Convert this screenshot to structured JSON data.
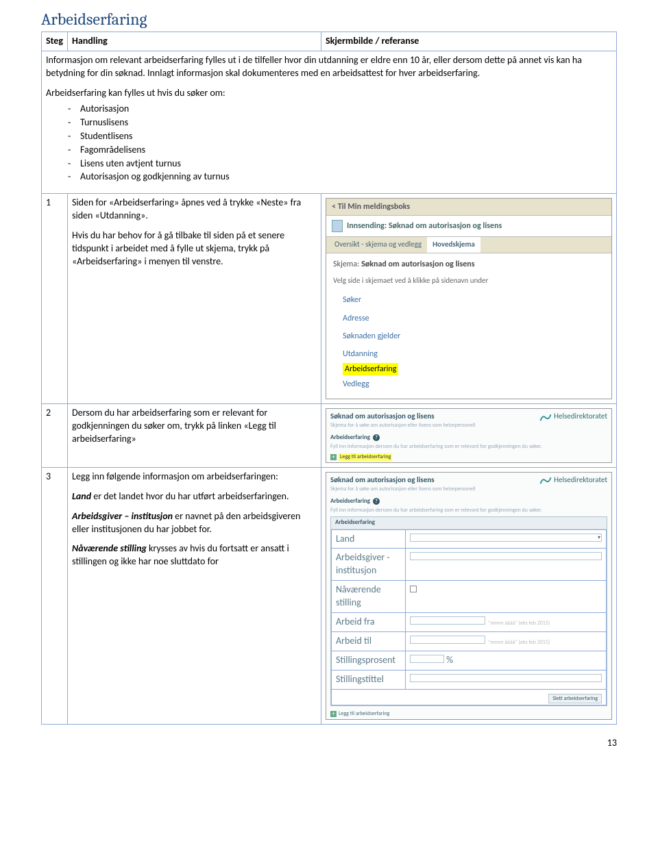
{
  "title": "Arbeidserfaring",
  "header": {
    "steg": "Steg",
    "handling": "Handling",
    "ref": "Skjermbilde / referanse"
  },
  "intro": {
    "p1": "Informasjon om relevant arbeidserfaring fylles ut i de tilfeller hvor din utdanning er eldre enn 10 år, eller dersom dette på annet vis kan ha betydning for din søknad. Innlagt informasjon skal dokumenteres med en arbeidsattest for hver arbeidserfaring.",
    "p2": "Arbeidserfaring kan fylles ut hvis du søker om:",
    "list": [
      "Autorisasjon",
      "Turnuslisens",
      "Studentlisens",
      "Fagområdelisens",
      "Lisens uten avtjent turnus",
      "Autorisasjon og godkjenning av turnus"
    ]
  },
  "row1": {
    "steg": "1",
    "p1": "Siden for «Arbeidserfaring» åpnes ved å trykke «Neste» fra siden «Utdanning».",
    "p2": "Hvis du har behov for å gå tilbake til siden på et senere tidspunkt i arbeidet med å fylle ut skjema, trykk på «Arbeidserfaring» i menyen til venstre."
  },
  "ss1": {
    "back": "< Til Min meldingsboks",
    "innsend": "Innsending: Søknad om autorisasjon og lisens",
    "tab1": "Oversikt - skjema og vedlegg",
    "tab2": "Hovedskjema",
    "schema_lbl": "Skjema:",
    "schema_val": "Søknad om autorisasjon og lisens",
    "hint": "Velg side i skjemaet ved å klikke på sidenavn under",
    "nav": [
      "Søker",
      "Adresse",
      "Søknaden gjelder",
      "Utdanning",
      "Arbeidserfaring",
      "Vedlegg"
    ]
  },
  "row2": {
    "steg": "2",
    "p1": "Dersom du har arbeidserfaring som er relevant for godkjenningen du søker om, trykk på linken «Legg til arbeidserfaring»"
  },
  "ss2": {
    "title": "Søknad om autorisasjon og lisens",
    "sub": "Skjema for å søke om autorisasjon eller lisens som helsepersonell",
    "logo": "Helsedirektoratet",
    "section": "Arbeidserfaring",
    "hint": "Fyll inn informasjon dersom du har arbeidserfaring som er relevant for godkjenningen du søker.",
    "addtext": "Legg til arbeidserfaring"
  },
  "row3": {
    "steg": "3",
    "p1": "Legg inn følgende informasjon om arbeidserfaringen:",
    "p2a": "Land ",
    "p2b": "er det landet hvor du har utført arbeidserfaringen.",
    "p3a": "Arbeidsgiver – institusjon ",
    "p3b": "er navnet på den arbeidsgiveren eller institusjonen du har jobbet for.",
    "p4a": "Nåværende stilling ",
    "p4b": "krysses av hvis du fortsatt er ansatt i stillingen og ikke har noe sluttdato for"
  },
  "ss3": {
    "title": "Søknad om autorisasjon og lisens",
    "sub": "Skjema for å søke om autorisasjon eller lisens som helsepersonell",
    "logo": "Helsedirektoratet",
    "section": "Arbeidserfaring",
    "hint": "Fyll inn informasjon dersom du har arbeidserfaring som er relevant for godkjenningen du søker.",
    "form_header": "Arbeidserfaring",
    "fields": {
      "land": "Land",
      "arbeidsgiver": "Arbeidsgiver - institusjon",
      "navarende": "Nåværende stilling",
      "fra": "Arbeid fra",
      "til": "Arbeid til",
      "prosent": "Stillingsprosent",
      "tittel": "Stillingstittel"
    },
    "eks": "\"mmm åååå\" (eks feb 2015)",
    "pct": "%",
    "slett": "Slett arbeidserfaring",
    "addtext": "Legg til arbeidserfaring"
  },
  "pagenum": "13"
}
